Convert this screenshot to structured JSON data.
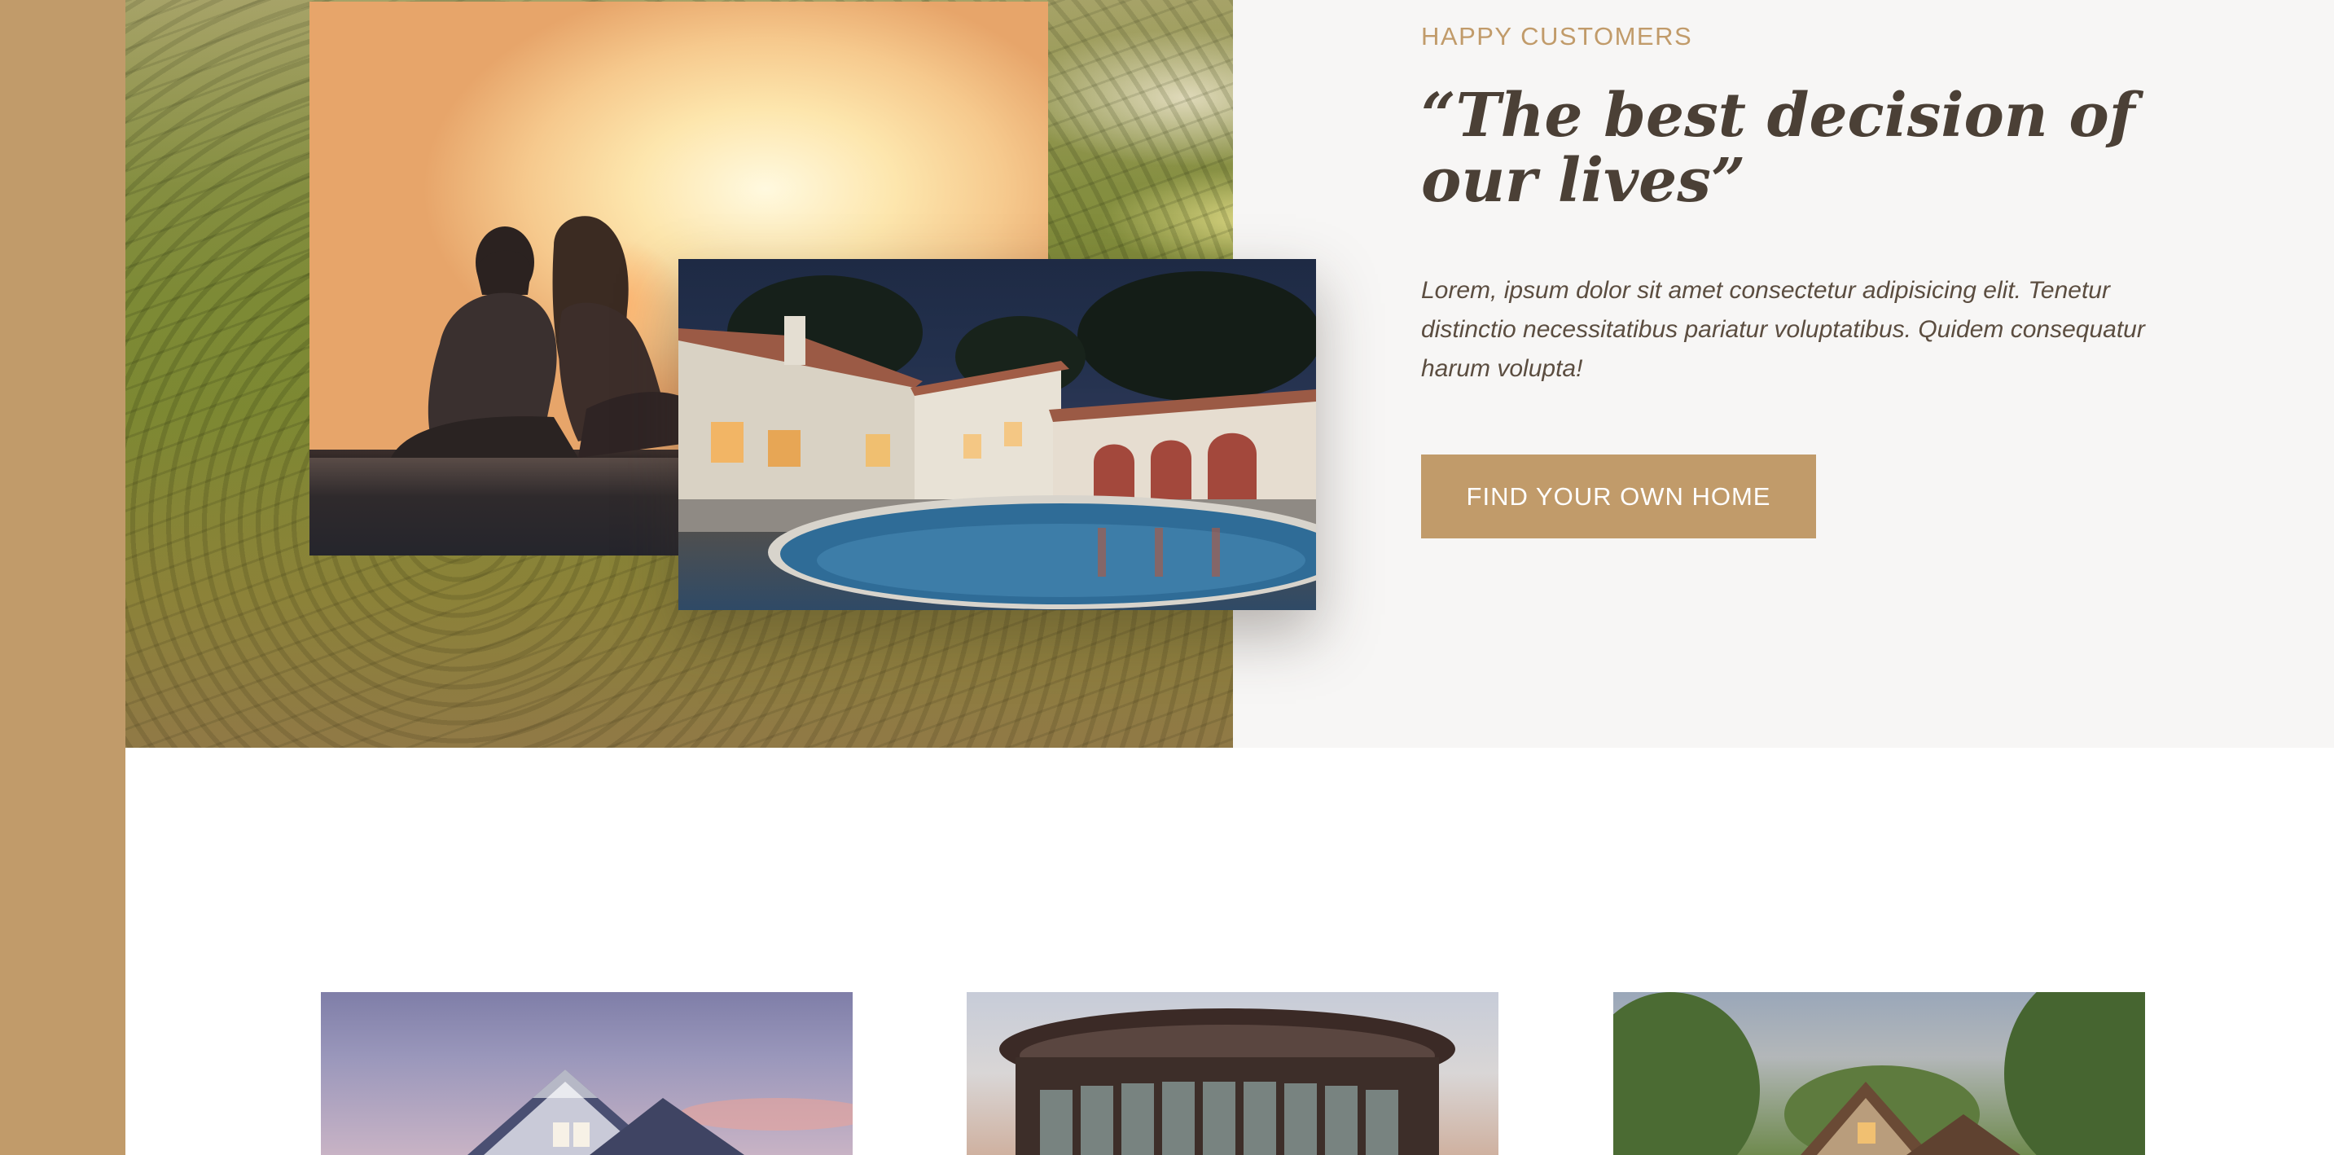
{
  "colors": {
    "accent": "#c19b6a",
    "heading": "#4b4036",
    "body_text": "#5b4d40",
    "section_bg": "#f7f6f5"
  },
  "testimonial": {
    "eyebrow": "HAPPY CUSTOMERS",
    "quote": "“The best decision of our lives”",
    "body": "Lorem, ipsum dolor sit amet consectetur adipisicing elit. Tenetur distinctio necessitatibus pariatur voluptatibus. Quidem consequatur harum volupta!",
    "cta_label": "FIND YOUR OWN HOME"
  },
  "images": {
    "background": "green-hills-photo",
    "couple": "couple-sunset-photo",
    "villa": "villa-pool-night-photo"
  },
  "listings": {
    "cards": [
      {
        "image": "blue-house-dusk-photo"
      },
      {
        "image": "round-modern-building-photo"
      },
      {
        "image": "stone-house-forest-photo"
      }
    ]
  }
}
